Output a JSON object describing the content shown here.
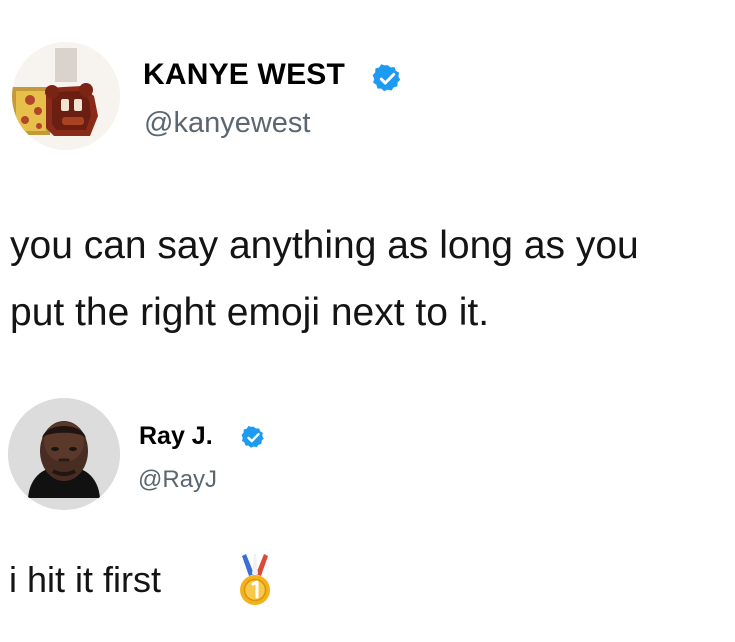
{
  "tweets": [
    {
      "author": {
        "name": "KANYE WEST",
        "handle": "@kanyewest",
        "verified": true,
        "avatar_icon": "kanye-avatar-bear-icon"
      },
      "text_lines": [
        "you can say anything as long as you",
        "put the right emoji next to it."
      ]
    },
    {
      "author": {
        "name": "Ray J.",
        "handle": "@RayJ",
        "verified": true,
        "avatar_icon": "rayj-avatar-portrait-icon"
      },
      "text": "i hit it first",
      "emoji": "first-place-medal-icon"
    }
  ],
  "colors": {
    "verified_blue": "#1d9bf0",
    "handle_gray": "#5b6670",
    "text": "#141414",
    "medal_gold": "#f3b21a"
  }
}
